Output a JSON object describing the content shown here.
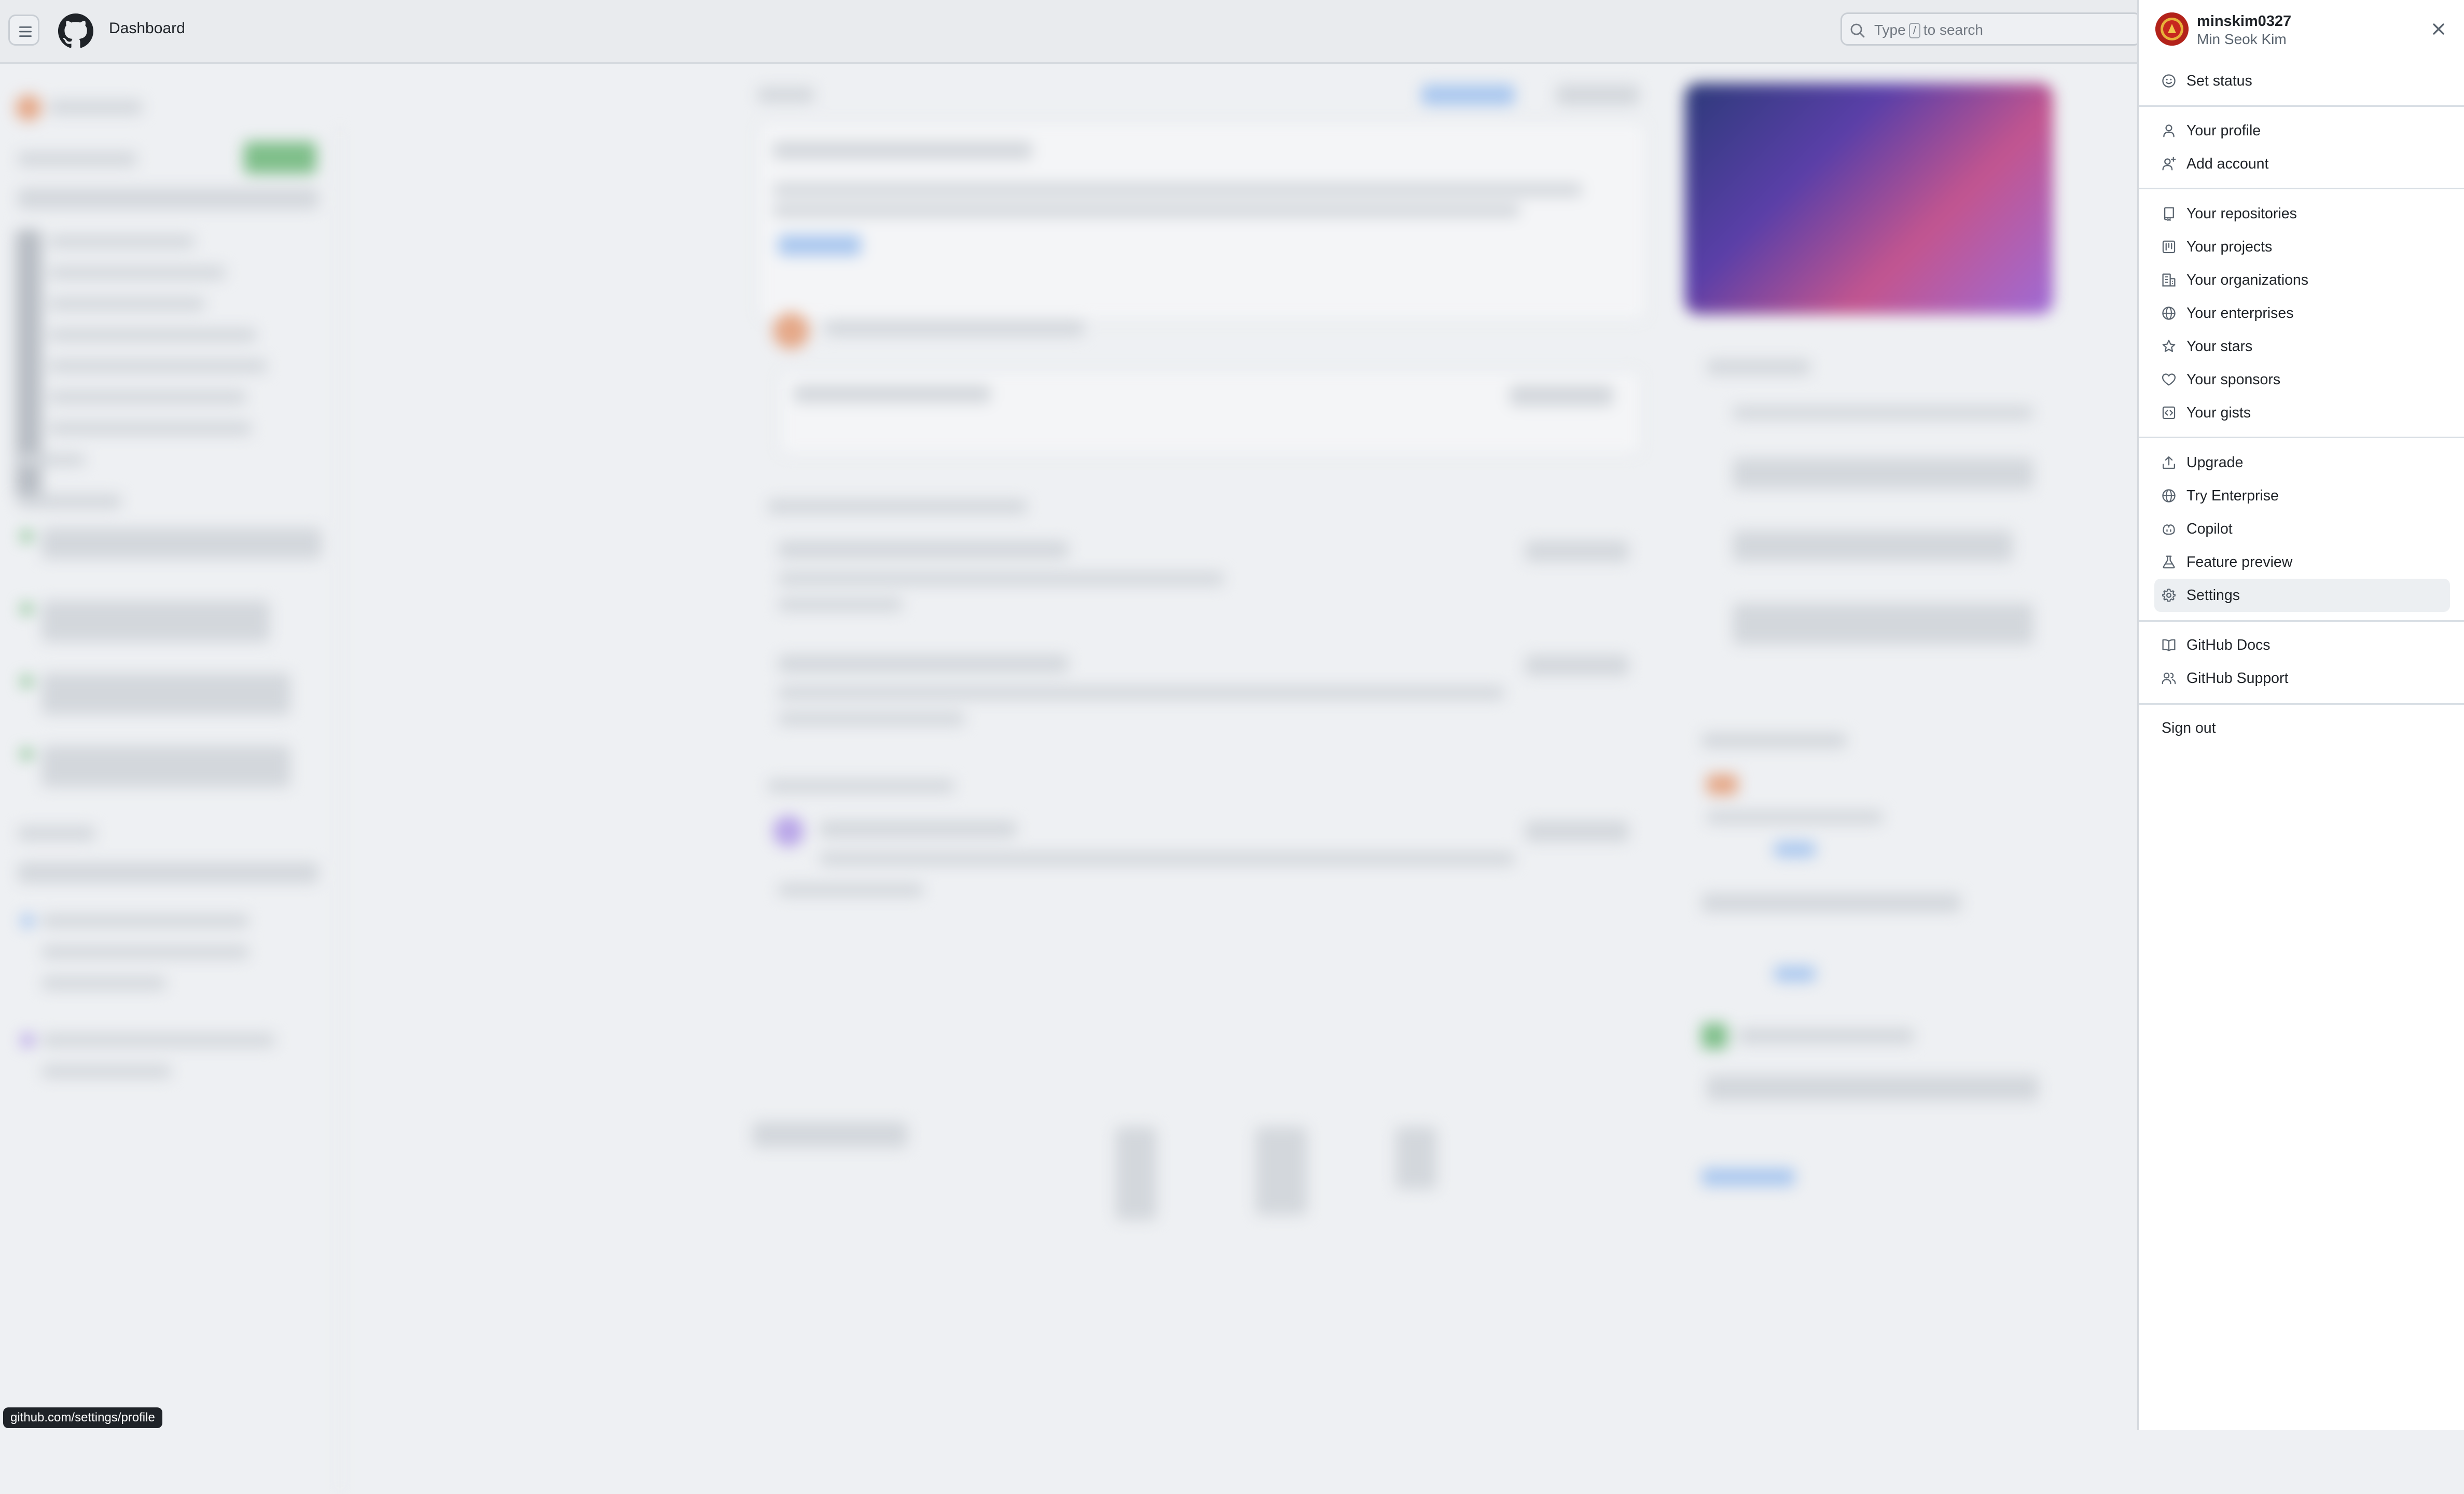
{
  "header": {
    "title": "Dashboard",
    "search_placeholder_prefix": "Type",
    "search_placeholder_key": "/",
    "search_placeholder_suffix": "to search"
  },
  "status_bar": {
    "url": "github.com/settings/profile"
  },
  "account_menu": {
    "username": "minskim0327",
    "full_name": "Min Seok Kim",
    "items": [
      {
        "label": "Set status",
        "icon": "smiley-icon"
      },
      {
        "label": "Your profile",
        "icon": "person-icon"
      },
      {
        "label": "Add account",
        "icon": "person-add-icon"
      },
      {
        "label": "Your repositories",
        "icon": "repo-icon"
      },
      {
        "label": "Your projects",
        "icon": "project-icon"
      },
      {
        "label": "Your organizations",
        "icon": "organization-icon"
      },
      {
        "label": "Your enterprises",
        "icon": "globe-icon"
      },
      {
        "label": "Your stars",
        "icon": "star-icon"
      },
      {
        "label": "Your sponsors",
        "icon": "heart-icon"
      },
      {
        "label": "Your gists",
        "icon": "code-square-icon"
      },
      {
        "label": "Upgrade",
        "icon": "upload-icon"
      },
      {
        "label": "Try Enterprise",
        "icon": "globe-icon"
      },
      {
        "label": "Copilot",
        "icon": "copilot-icon"
      },
      {
        "label": "Feature preview",
        "icon": "beaker-icon"
      },
      {
        "label": "Settings",
        "icon": "gear-icon",
        "selected": true
      },
      {
        "label": "GitHub Docs",
        "icon": "book-icon"
      },
      {
        "label": "GitHub Support",
        "icon": "people-icon"
      },
      {
        "label": "Sign out"
      }
    ]
  }
}
